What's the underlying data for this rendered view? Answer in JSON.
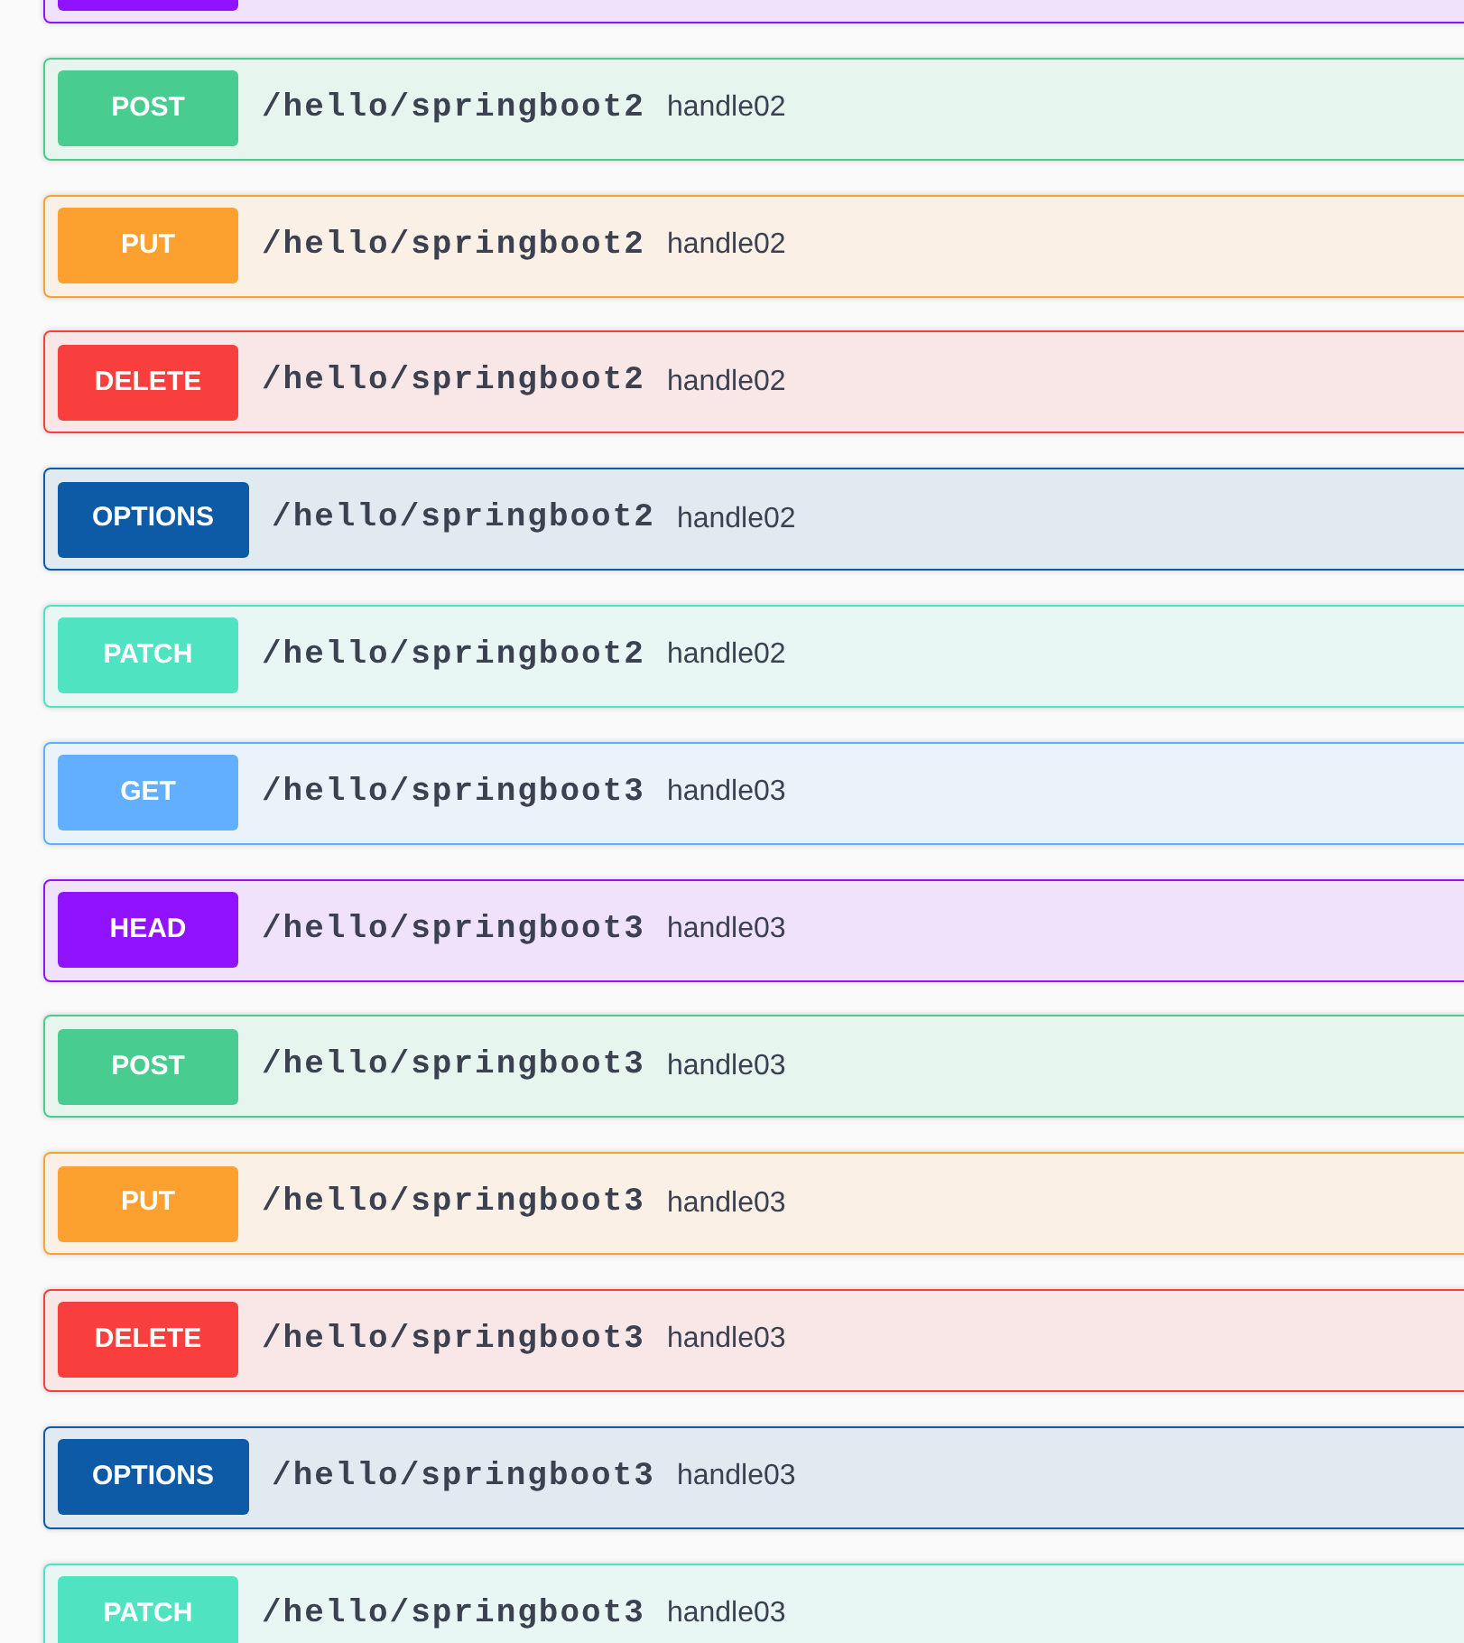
{
  "operations": [
    {
      "kind": "head"
    },
    {
      "kind": "post",
      "method": "POST",
      "path": "/hello/springboot2",
      "summary": "handle02"
    },
    {
      "kind": "put",
      "method": "PUT",
      "path": "/hello/springboot2",
      "summary": "handle02"
    },
    {
      "kind": "delete",
      "method": "DELETE",
      "path": "/hello/springboot2",
      "summary": "handle02"
    },
    {
      "kind": "options",
      "method": "OPTIONS",
      "path": "/hello/springboot2",
      "summary": "handle02"
    },
    {
      "kind": "patch",
      "method": "PATCH",
      "path": "/hello/springboot2",
      "summary": "handle02"
    },
    {
      "kind": "get",
      "method": "GET",
      "path": "/hello/springboot3",
      "summary": "handle03"
    },
    {
      "kind": "head",
      "method": "HEAD",
      "path": "/hello/springboot3",
      "summary": "handle03"
    },
    {
      "kind": "post",
      "method": "POST",
      "path": "/hello/springboot3",
      "summary": "handle03"
    },
    {
      "kind": "put",
      "method": "PUT",
      "path": "/hello/springboot3",
      "summary": "handle03"
    },
    {
      "kind": "delete",
      "method": "DELETE",
      "path": "/hello/springboot3",
      "summary": "handle03"
    },
    {
      "kind": "options",
      "method": "OPTIONS",
      "path": "/hello/springboot3",
      "summary": "handle03"
    },
    {
      "kind": "patch",
      "method": "PATCH",
      "path": "/hello/springboot3",
      "summary": "handle03"
    }
  ]
}
